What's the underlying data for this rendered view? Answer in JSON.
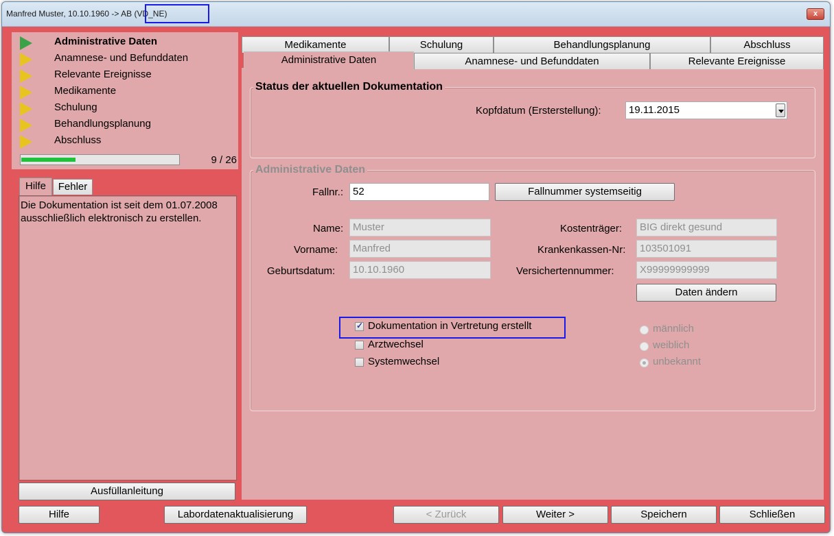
{
  "window": {
    "title_prefix": "Manfred Muster, 10.10.1960 -> ",
    "title_highlight": "AB (VD_NE)",
    "close_label": "x"
  },
  "sidebar": {
    "nav_items": [
      {
        "label": "Administrative Daten",
        "active": true
      },
      {
        "label": "Anamnese- und Befunddaten"
      },
      {
        "label": "Relevante Ereignisse"
      },
      {
        "label": "Medikamente"
      },
      {
        "label": "Schulung"
      },
      {
        "label": "Behandlungsplanung"
      },
      {
        "label": "Abschluss"
      }
    ],
    "progress": {
      "text": "9 / 26",
      "value": 9,
      "total": 26
    },
    "help_tabs": [
      "Hilfe",
      "Fehler"
    ],
    "help_text": "Die Dokumentation ist seit dem 01.07.2008 ausschließlich elektronisch zu erstellen.",
    "guide_button": "Ausfüllanleitung"
  },
  "tabs": {
    "row_back": [
      "Medikamente",
      "Schulung",
      "Behandlungsplanung",
      "Abschluss"
    ],
    "row_front": [
      "Administrative Daten",
      "Anamnese- und Befunddaten",
      "Relevante Ereignisse"
    ],
    "active": "Administrative Daten"
  },
  "status_group": {
    "title": "Status der aktuellen Dokumentation",
    "kopfdatum_label": "Kopfdatum (Ersterstellung):",
    "kopfdatum_value": "19.11.2015"
  },
  "admin_group": {
    "title": "Administrative Daten",
    "fallnr_label": "Fallnr.:",
    "fallnr_value": "52",
    "fallnr_button": "Fallnummer systemseitig",
    "name_label": "Name:",
    "name_value": "Muster",
    "vorname_label": "Vorname:",
    "vorname_value": "Manfred",
    "geburtsdatum_label": "Geburtsdatum:",
    "geburtsdatum_value": "10.10.1960",
    "kostentraeger_label": "Kostenträger:",
    "kostentraeger_value": "BIG direkt gesund",
    "kassennr_label": "Krankenkassen-Nr:",
    "kassennr_value": "103501091",
    "versnr_label": "Versichertennummer:",
    "versnr_value": "X99999999999",
    "change_button": "Daten ändern",
    "checkboxes": [
      {
        "label": "Dokumentation in Vertretung erstellt",
        "checked": true
      },
      {
        "label": "Arztwechsel",
        "checked": false
      },
      {
        "label": "Systemwechsel",
        "checked": false
      }
    ],
    "radios": [
      {
        "label": "männlich",
        "checked": false
      },
      {
        "label": "weiblich",
        "checked": false
      },
      {
        "label": "unbekannt",
        "checked": true
      }
    ]
  },
  "footer": {
    "hilfe": "Hilfe",
    "labor": "Labordatenaktualisierung",
    "zurueck": "< Zurück",
    "weiter": "Weiter >",
    "speichern": "Speichern",
    "schliessen": "Schließen"
  },
  "colors": {
    "window_bg": "#e2575c",
    "panel_bg": "#e0a8aa",
    "progress_fill": "#22c13b",
    "highlight_box": "#1a1ae6"
  }
}
